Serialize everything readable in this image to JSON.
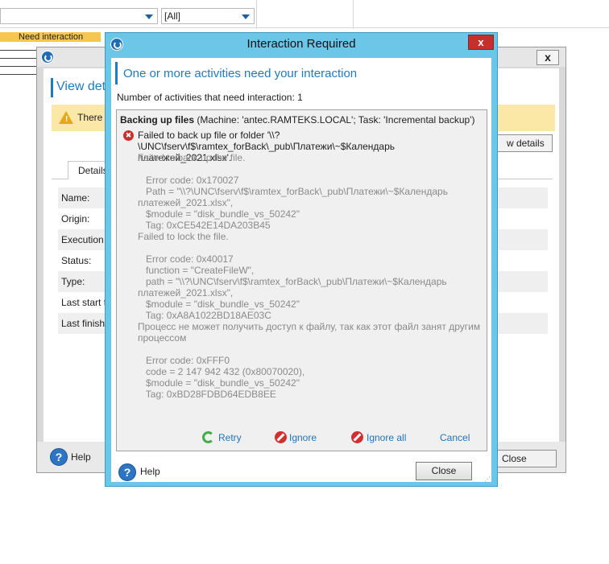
{
  "background": {
    "combo_left_value": "",
    "combo_right_value": "[All]",
    "need_interaction_badge": "Need interaction"
  },
  "back_window": {
    "heading": "View deta",
    "warning_text": "There a",
    "view_details_button": "w details",
    "tab_details": "Details",
    "properties": [
      "Name:",
      "Origin:",
      "Execution s",
      "Status:",
      "Type:",
      "Last start t",
      "Last finish"
    ],
    "help_label": "Help",
    "close_button": "Close",
    "close_x": "x"
  },
  "modal": {
    "title": "Interaction Required",
    "close_x": "x",
    "heading": "One or more activities need your interaction",
    "count_text": "Number of activities that need interaction: 1",
    "details": {
      "activity_bold": "Backing up files",
      "activity_rest": " (Machine: 'antec.RAMTEKS.LOCAL'; Task: 'Incremental backup')",
      "error_line": "Failed to back up file or folder '\\\\?\\UNC\\fserv\\f$\\ramtex_forBack\\_pub\\Платежи\\~$Календарь платежей_2021.xlsx'.",
      "gray_lines": [
        "Failed to back up the file.",
        "",
        "   Error code: 0x170027",
        "   Path = \"\\\\?\\UNC\\fserv\\f$\\ramtex_forBack\\_pub\\Платежи\\~$Календарь",
        "платежей_2021.xlsx\",",
        "   $module = \"disk_bundle_vs_50242\"",
        "   Tag: 0xCE542E14DA203B45",
        "Failed to lock the file.",
        "",
        "   Error code: 0x40017",
        "   function = \"CreateFileW\",",
        "   path = \"\\\\?\\UNC\\fserv\\f$\\ramtex_forBack\\_pub\\Платежи\\~$Календарь",
        "платежей_2021.xlsx\",",
        "   $module = \"disk_bundle_vs_50242\"",
        "   Tag: 0xA8A1022BD18AE03C",
        "Процесс не может получить доступ к файлу, так как этот файл занят другим",
        "процессом",
        "",
        "   Error code: 0xFFF0",
        "   code = 2 147 942 432 (0x80070020),",
        "   $module = \"disk_bundle_vs_50242\"",
        "   Tag: 0xBD28FDBD64EDB8EE"
      ]
    },
    "actions": {
      "retry": "Retry",
      "ignore": "Ignore",
      "ignore_all": "Ignore all",
      "cancel": "Cancel"
    },
    "help_label": "Help",
    "close_button": "Close"
  },
  "colors": {
    "modal_frame": "#6cc6e8",
    "accent_blue": "#1f7bbd",
    "close_red": "#c4302b",
    "warning_yellow": "#fbe8a6",
    "link_blue": "#1f73b7"
  }
}
